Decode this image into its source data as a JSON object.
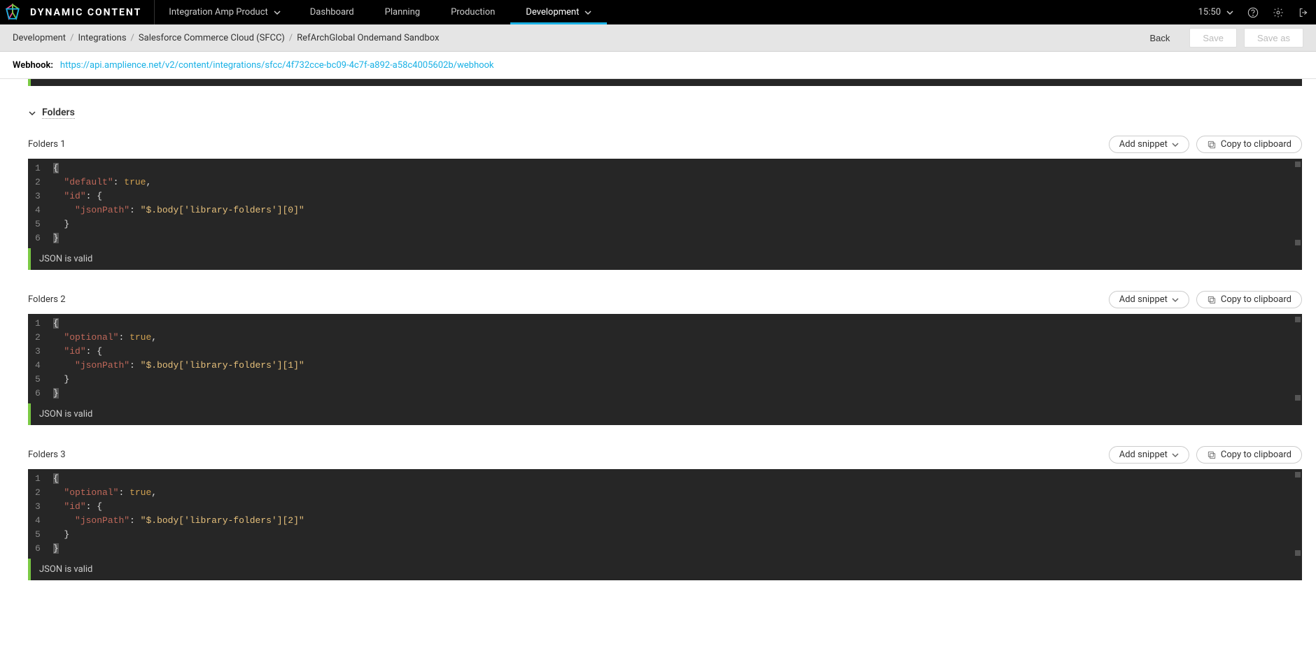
{
  "colors": {
    "accent": "#1ab1e5",
    "valid_green": "#7ac943"
  },
  "brand": "DYNAMIC CONTENT",
  "product_selector": "Integration Amp Product",
  "nav": {
    "dashboard": "Dashboard",
    "planning": "Planning",
    "production": "Production",
    "development": "Development"
  },
  "active_tab": "Development",
  "time": "15:50",
  "breadcrumb": {
    "items": [
      "Development",
      "Integrations",
      "Salesforce Commerce Cloud (SFCC)",
      "RefArchGlobal Ondemand Sandbox"
    ]
  },
  "actions": {
    "back": "Back",
    "save": "Save",
    "save_as": "Save as"
  },
  "webhook": {
    "label": "Webhook:",
    "url": "https://api.amplience.net/v2/content/integrations/sfcc/4f732cce-bc09-4c7f-a892-a58c4005602b/webhook"
  },
  "section": {
    "folders_label": "Folders"
  },
  "buttons": {
    "add_snippet": "Add snippet",
    "copy_clipboard": "Copy to clipboard"
  },
  "status_valid": "JSON is valid",
  "folders": [
    {
      "title": "Folders 1",
      "lines": [
        "1",
        "2",
        "3",
        "4",
        "5",
        "6"
      ],
      "json": {
        "default": true,
        "id": {
          "jsonPath": "$.body['library-folders'][0]"
        }
      }
    },
    {
      "title": "Folders 2",
      "lines": [
        "1",
        "2",
        "3",
        "4",
        "5",
        "6"
      ],
      "json": {
        "optional": true,
        "id": {
          "jsonPath": "$.body['library-folders'][1]"
        }
      }
    },
    {
      "title": "Folders 3",
      "lines": [
        "1",
        "2",
        "3",
        "4",
        "5",
        "6"
      ],
      "json": {
        "optional": true,
        "id": {
          "jsonPath": "$.body['library-folders'][2]"
        }
      }
    }
  ],
  "chart_data": null
}
